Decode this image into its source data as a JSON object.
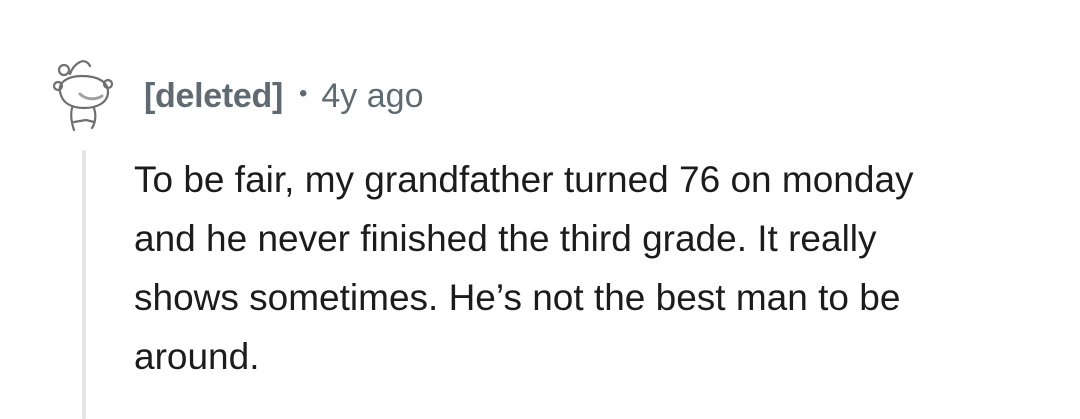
{
  "comment": {
    "author": "[deleted]",
    "separator": "•",
    "age": "4y ago",
    "body_lines": [
      "To be fair, my grandfather turned 76 on monday",
      "and he never finished the third grade. It really",
      "shows sometimes. He’s not the best man to be",
      "around."
    ]
  },
  "icons": {
    "avatar": "snoo-avatar-icon"
  },
  "colors": {
    "meta_text": "#5f6b73",
    "body_text": "#1c1c1c",
    "thread_line": "#e4e4e4"
  }
}
